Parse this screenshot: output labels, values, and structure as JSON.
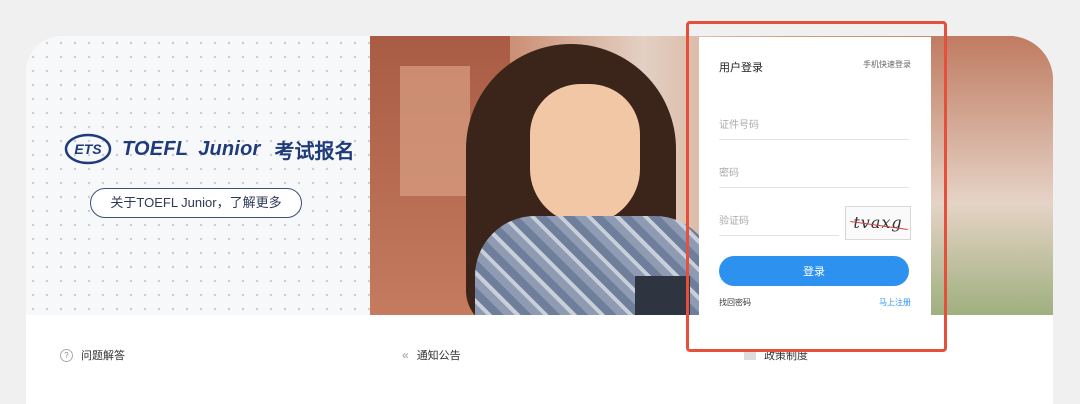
{
  "brand": {
    "ets": "ETS",
    "toefl": "TOEFL",
    "junior": "Junior",
    "cn_title": "考试报名",
    "about_label": "关于TOEFL Junior，了解更多"
  },
  "login": {
    "title": "用户登录",
    "quick_login": "手机快速登录",
    "id_placeholder": "证件号码",
    "password_placeholder": "密码",
    "captcha_placeholder": "验证码",
    "captcha_text": "tvaxg",
    "login_button": "登录",
    "forgot": "找回密码",
    "register": "马上注册"
  },
  "bottom": {
    "faq": "问题解答",
    "notice": "通知公告",
    "policy": "政策制度"
  },
  "colors": {
    "accent": "#2d91f0",
    "highlight": "#e5503c",
    "brand": "#1f3b7a"
  }
}
